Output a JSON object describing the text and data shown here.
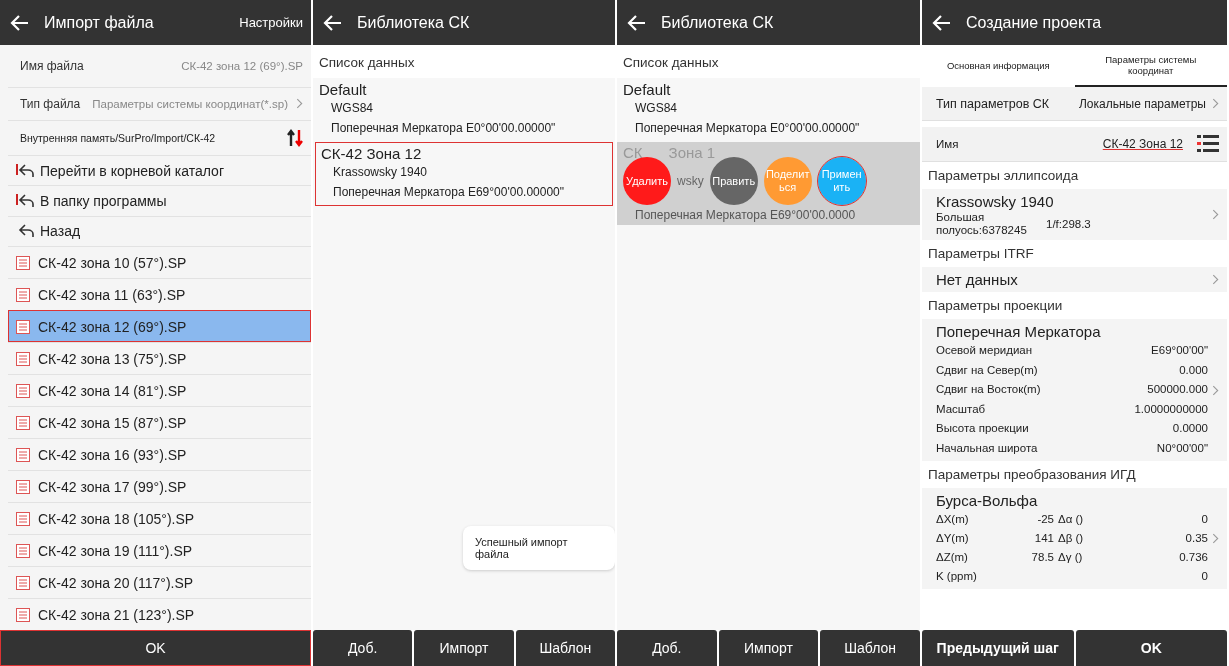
{
  "import_screen": {
    "title": "Импорт файла",
    "settings_link": "Настройки",
    "fields": [
      {
        "kind": "name",
        "label": "Имя файла",
        "value": "СК-42 зона 12 (69°).SP"
      },
      {
        "kind": "type",
        "label": "Тип файла",
        "value": "Параметры системы координат(*.sp)"
      }
    ],
    "path": "Внутренняя память/SurPro/Import/СК-42",
    "nav_items": [
      {
        "kind": "root",
        "label": "Перейти в корневой каталог"
      },
      {
        "kind": "root",
        "label": "В папку программы"
      },
      {
        "kind": "back",
        "label": "Назад"
      }
    ],
    "files": [
      {
        "name": "СК-42 зона 10 (57°).SP",
        "selected": false
      },
      {
        "name": "СК-42 зона 11 (63°).SP",
        "selected": false
      },
      {
        "name": "СК-42 зона 12 (69°).SP",
        "selected": true
      },
      {
        "name": "СК-42 зона 13 (75°).SP",
        "selected": false
      },
      {
        "name": "СК-42 зона 14 (81°).SP",
        "selected": false
      },
      {
        "name": "СК-42 зона 15 (87°).SP",
        "selected": false
      },
      {
        "name": "СК-42 зона 16 (93°).SP",
        "selected": false
      },
      {
        "name": "СК-42 зона 17 (99°).SP",
        "selected": false
      },
      {
        "name": "СК-42 зона 18 (105°).SP",
        "selected": false
      },
      {
        "name": "СК-42 зона 19 (111°).SP",
        "selected": false
      },
      {
        "name": "СК-42 зона 20 (117°).SP",
        "selected": false
      },
      {
        "name": "СК-42 зона 21 (123°).SP",
        "selected": false
      }
    ],
    "ok_button": {
      "label": "OK",
      "highlighted": true
    }
  },
  "library_screen": {
    "title": "Библиотека СК",
    "section": "Список данных",
    "groups": [
      {
        "name": "Default",
        "lines": [
          "WGS84",
          "Поперечная Меркатора E0°00'00.00000\""
        ],
        "highlighted": false
      },
      {
        "name": "СК-42 Зона 12",
        "lines": [
          "Krassowsky 1940",
          "Поперечная Меркатора E69°00'00.00000\""
        ],
        "highlighted": true
      }
    ],
    "toast": "Успешный импорт файла",
    "buttons": [
      "Доб.",
      "Импорт",
      "Шаблон"
    ]
  },
  "library_swipe_screen": {
    "title": "Библиотека СК",
    "section": "Список данных",
    "groups": [
      {
        "name": "Default",
        "lines": [
          "WGS84",
          "Поперечная Меркатора E0°00'00.00000\""
        ]
      }
    ],
    "swiped_row": {
      "top_fragments": [
        "СК",
        "Зона 1"
      ],
      "middle_fragment": "wsky",
      "bottom_line": "Поперечная Меркатора E69°00'00.0000",
      "actions": [
        {
          "label": "Удалить",
          "color": "#ff1a1a",
          "highlighted": false
        },
        {
          "label": "Править",
          "color": "#666666",
          "highlighted": false
        },
        {
          "label": "Поделиться",
          "color": "#ff9a33",
          "highlighted": false
        },
        {
          "label": "Применить",
          "color": "#1ab2f5",
          "highlighted": true
        }
      ]
    },
    "buttons": [
      "Доб.",
      "Импорт",
      "Шаблон"
    ]
  },
  "project_screen": {
    "title": "Создание проекта",
    "tabs": [
      {
        "label": "Основная информация",
        "selected": false
      },
      {
        "label": "Параметры системы координат",
        "selected": true
      }
    ],
    "param_type": {
      "label": "Тип параметров СК",
      "value": "Локальные параметры"
    },
    "name_row": {
      "label": "Имя",
      "value": "СК-42 Зона 12"
    },
    "ellipsoid_section": "Параметры эллипсоида",
    "ellipsoid": {
      "name": "Krassowsky 1940",
      "semi_major": "Большая полуось:6378245",
      "flattening": "1/f:298.3"
    },
    "itrf_section": "Параметры ITRF",
    "itrf": "Нет данных",
    "projection_section": "Параметры проекции",
    "projection": {
      "name": "Поперечная Меркатора",
      "rows": [
        {
          "label": "Осевой меридиан",
          "value": "E69°00'00\""
        },
        {
          "label": "Сдвиг на Север(m)",
          "value": "0.000"
        },
        {
          "label": "Сдвиг на Восток(m)",
          "value": "500000.000"
        },
        {
          "label": "Масштаб",
          "value": "1.0000000000"
        },
        {
          "label": "Высота проекции",
          "value": "0.0000"
        },
        {
          "label": "Начальная широта",
          "value": "N0°00'00\""
        }
      ]
    },
    "transform_section": "Параметры преобразования ИГД",
    "transform": {
      "name": "Бурса-Вольфа",
      "rows": [
        {
          "label": "ΔX(m)",
          "value": "-25",
          "label_2": "Δα ()",
          "value_2": "0"
        },
        {
          "label": "ΔY(m)",
          "value": "141",
          "label_2": "Δβ ()",
          "value_2": "0.35"
        },
        {
          "label": "ΔZ(m)",
          "value": "78.5",
          "label_2": "Δγ ()",
          "value_2": "0.736"
        },
        {
          "label": "K (ppm)",
          "value": "",
          "label_2": "",
          "value_2": "0"
        }
      ]
    },
    "buttons": [
      "Предыдущий шаг",
      "OK"
    ]
  }
}
